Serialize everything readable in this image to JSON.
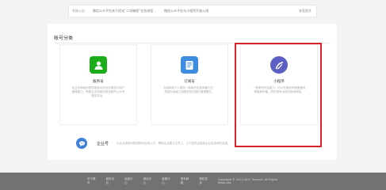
{
  "notice": {
    "label": "系统公告",
    "items": [
      "微信公众平台关于优化“二次确权”业务流程…",
      "微信公众平台与小程序开放公测"
    ],
    "more": "查看更多"
  },
  "section": {
    "title": "帐号分类"
  },
  "cards": [
    {
      "name": "服务号",
      "description": "给企业和组织提供更强大的业务服务与用户管理能力，帮助企业快速实现全新的公众号服务平台。",
      "icon": "service-account-icon",
      "color": "#1aad19"
    },
    {
      "name": "订阅号",
      "description": "为媒体和个人提供一种新的信息传播方式，构建与读者之间更好的沟通与管理模式。",
      "icon": "subscription-account-icon",
      "color": "#3d8ce0"
    },
    {
      "name": "小程序",
      "description": "一种新的开放能力，可以在微信内被便捷地获取和传播，同时具有出色的使用体验。",
      "icon": "mini-program-icon",
      "color": "#5b5fc4"
    }
  ],
  "enterprise": {
    "name": "企业号",
    "description": "为企业或组织提供移动应用入口，帮助企业建立与员工、上下游供应链及企业应用间的连接。",
    "icon": "enterprise-account-icon",
    "color": "#3e7fd8"
  },
  "highlight_color": "#d9232b",
  "footer": {
    "links": [
      "关于腾讯",
      "服务协议",
      "运营中心",
      "辟谣中心",
      "客服中心",
      "联系邮箱",
      "侵权投诉"
    ],
    "copyright": "Copyright © 2012-2017 Tencent. All Rights Reserved."
  }
}
